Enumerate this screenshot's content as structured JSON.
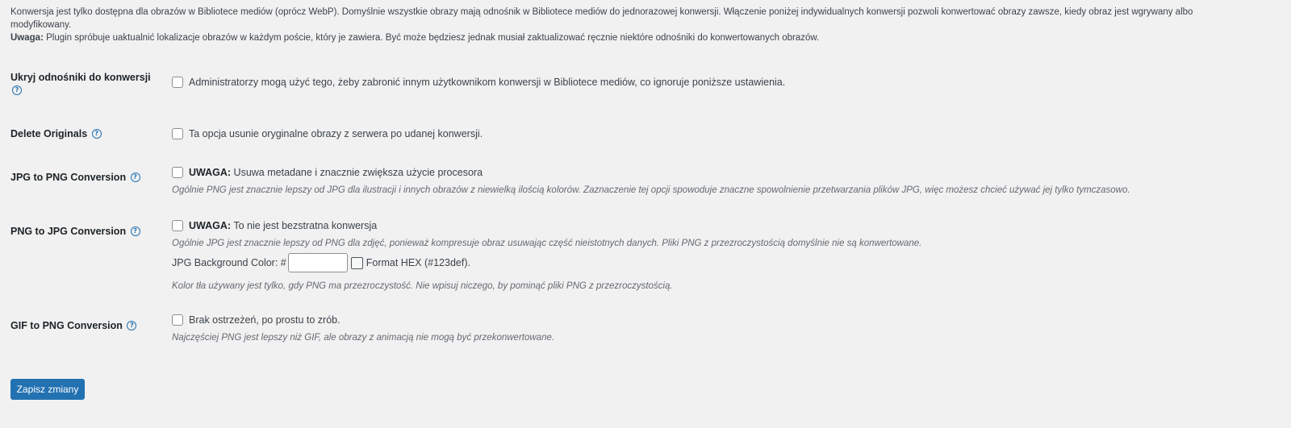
{
  "intro": {
    "line1": "Konwersja jest tylko dostępna dla obrazów w Bibliotece mediów (oprócz WebP). Domyślnie wszystkie obrazy mają odnośnik w Bibliotece mediów do jednorazowej konwersji. Włączenie poniżej indywidualnych konwersji pozwoli konwertować obrazy zawsze, kiedy obraz jest wgrywany albo modyfikowany.",
    "note_label": "Uwaga:",
    "note_text": " Plugin spróbuje uaktualnić lokalizacje obrazów w każdym poście, który je zawiera. Być może będziesz jednak musiał zaktualizować ręcznie niektóre odnośniki do konwertowanych obrazów."
  },
  "help_icon_glyph": "?",
  "settings": {
    "hide_links": {
      "label": "Ukryj odnośniki do konwersji",
      "checked": false,
      "text": "Administratorzy mogą użyć tego, żeby zabronić innym użytkownikom konwersji w Bibliotece mediów, co ignoruje poniższe ustawienia."
    },
    "delete_originals": {
      "label": "Delete Originals",
      "checked": false,
      "text": "Ta opcja usunie oryginalne obrazy z serwera po udanej konwersji."
    },
    "jpg_to_png": {
      "label": "JPG to PNG Conversion",
      "checked": false,
      "warning": "UWAGA:",
      "text": " Usuwa metadane i znacznie zwiększa użycie procesora",
      "desc": "Ogólnie PNG jest znacznie lepszy od JPG dla ilustracji i innych obrazów z niewielką ilością kolorów. Zaznaczenie tej opcji spowoduje znaczne spowolnienie przetwarzania plików JPG, więc możesz chcieć używać jej tylko tymczasowo."
    },
    "png_to_jpg": {
      "label": "PNG to JPG Conversion",
      "checked": false,
      "warning": "UWAGA:",
      "text": " To nie jest bezstratna konwersja",
      "desc": "Ogólnie JPG jest znacznie lepszy od PNG dla zdjęć, ponieważ kompresuje obraz usuwając część nieistotnych danych. Pliki PNG z przezroczystością domyślnie nie są konwertowane.",
      "bg_color_label": "JPG Background Color: #",
      "bg_color_value": "",
      "format_hint": "Format HEX (#123def).",
      "bg_desc": "Kolor tła używany jest tylko, gdy PNG ma przezroczystość. Nie wpisuj niczego, by pominąć pliki PNG z przezroczystością."
    },
    "gif_to_png": {
      "label": "GIF to PNG Conversion",
      "checked": false,
      "text": "Brak ostrzeżeń, po prostu to zrób.",
      "desc": "Najczęściej PNG jest lepszy niż GIF, ale obrazy z animacją nie mogą być przekonwertowane."
    }
  },
  "save_button": {
    "label": "Zapisz zmiany",
    "color": "#2271b1"
  }
}
